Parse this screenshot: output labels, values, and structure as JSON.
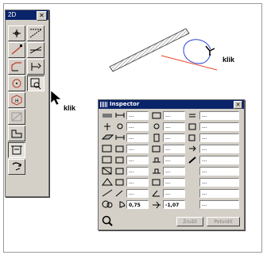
{
  "palette": {
    "title": "2D",
    "close": "✕"
  },
  "annotations": {
    "klik_drawing": "klik",
    "klik_palette": "klik"
  },
  "inspector": {
    "title": "Inspector",
    "close": "✕",
    "rows": [
      [
        "---",
        "---",
        "---"
      ],
      [
        "---",
        "---",
        "---"
      ],
      [
        "---",
        "---",
        "---"
      ],
      [
        "---",
        "---",
        "---"
      ],
      [
        "---",
        "---",
        "---"
      ],
      [
        "---",
        "---",
        "---"
      ],
      [
        "---",
        "---",
        "---"
      ],
      [
        "---",
        "---",
        "---"
      ],
      [
        "---",
        "---",
        "---"
      ],
      [
        "0,75",
        "-1,07",
        "---"
      ]
    ],
    "cancel_label": "Zrušit",
    "apply_label": "Potvrdit"
  },
  "colors": {
    "titlebar": "#0a246a",
    "panel": "#d4d0c8",
    "red_line": "#e8452c",
    "arc": "#2a3fd0"
  },
  "icons": [
    "cross-hair-icon",
    "rect-dash-icon",
    "line-icon",
    "polyline-icon",
    "arc-icon",
    "dim-icon",
    "circle-icon",
    "detail-icon",
    "hotspot-icon",
    "fill-icon",
    "text-icon",
    "label-icon",
    "rotate-icon"
  ]
}
